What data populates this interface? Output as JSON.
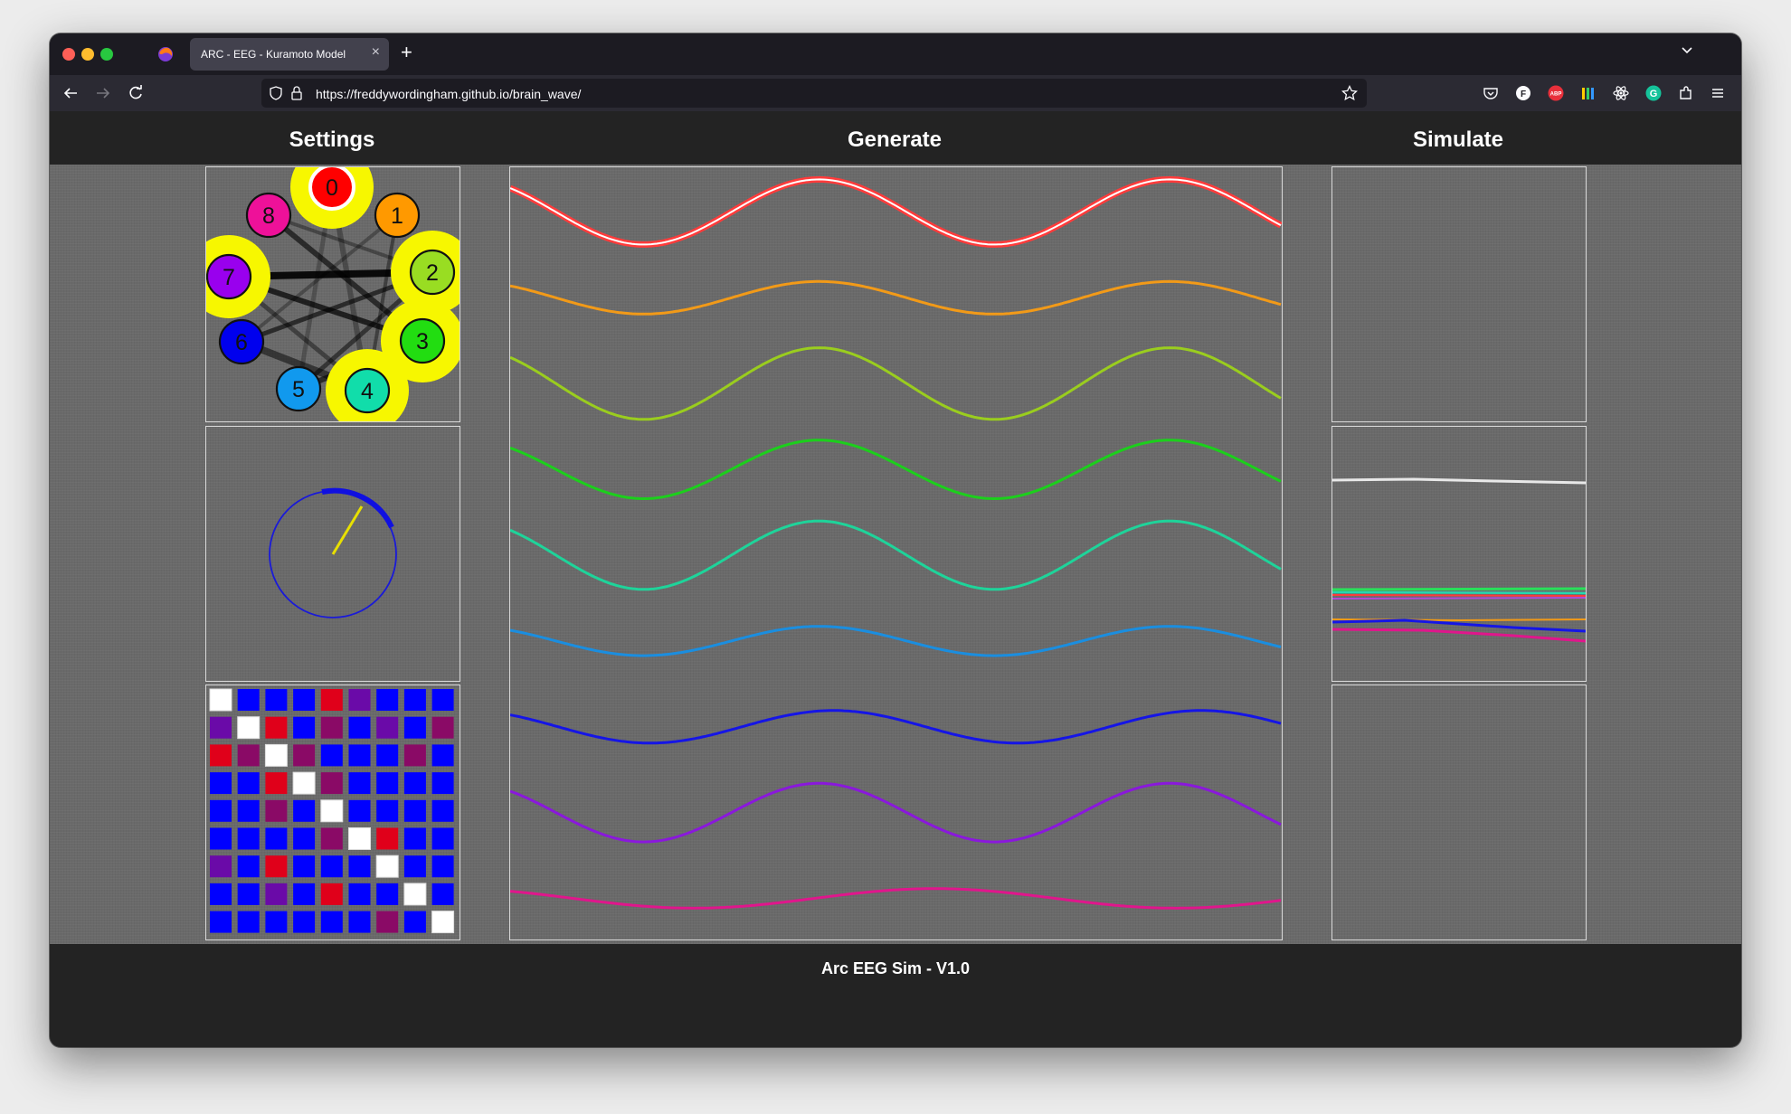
{
  "browser": {
    "tab_title": "ARC - EEG - Kuramoto Model",
    "url": "https://freddywordingham.github.io/brain_wave/",
    "tab_close": "×",
    "new_tab": "+"
  },
  "page": {
    "settings_title": "Settings",
    "generate_title": "Generate",
    "simulate_title": "Simulate",
    "footer": "Arc EEG Sim - V1.0"
  },
  "oscillators": [
    {
      "label": "0",
      "color": "#ff0000",
      "highlight": true
    },
    {
      "label": "1",
      "color": "#ff9900",
      "highlight": false
    },
    {
      "label": "2",
      "color": "#99dd22",
      "highlight": true
    },
    {
      "label": "3",
      "color": "#22dd11",
      "highlight": true
    },
    {
      "label": "4",
      "color": "#11ddaa",
      "highlight": true
    },
    {
      "label": "5",
      "color": "#1199ee",
      "highlight": false
    },
    {
      "label": "6",
      "color": "#0000ee",
      "highlight": false
    },
    {
      "label": "7",
      "color": "#9900ee",
      "highlight": true
    },
    {
      "label": "8",
      "color": "#ee1199",
      "highlight": false
    }
  ],
  "colors": {
    "wave_colors": [
      "#ff3b3b",
      "#f29a18",
      "#9acd1e",
      "#1ccf1c",
      "#1ed49a",
      "#1a8ee0",
      "#1515e6",
      "#8a18dc",
      "#e0168c"
    ],
    "matrix_blue": "#0000ff",
    "matrix_red": "#e0001a",
    "matrix_purple": "#6a0aa8",
    "matrix_magenta": "#8a0a66",
    "matrix_white": "#ffffff"
  },
  "chart_data": [
    {
      "type": "line",
      "title": "Generate",
      "series": [
        {
          "color": "#ff3b3b",
          "amplitude": 1.0,
          "periods": 2.2
        },
        {
          "color": "#f29a18",
          "amplitude": 0.5,
          "periods": 2.2
        },
        {
          "color": "#9acd1e",
          "amplitude": 1.1,
          "periods": 2.2
        },
        {
          "color": "#1ccf1c",
          "amplitude": 0.9,
          "periods": 2.2
        },
        {
          "color": "#1ed49a",
          "amplitude": 1.05,
          "periods": 2.2
        },
        {
          "color": "#1a8ee0",
          "amplitude": 0.45,
          "periods": 2.2
        },
        {
          "color": "#1515e6",
          "amplitude": 0.5,
          "periods": 2.1
        },
        {
          "color": "#8a18dc",
          "amplitude": 0.9,
          "periods": 2.2
        },
        {
          "color": "#e0168c",
          "amplitude": 0.3,
          "periods": 1.6
        }
      ]
    }
  ],
  "phase_matrix": [
    [
      "W",
      "B",
      "B",
      "B",
      "R",
      "P",
      "B",
      "B",
      "B"
    ],
    [
      "P",
      "W",
      "R",
      "B",
      "M",
      "B",
      "P",
      "B",
      "M"
    ],
    [
      "R",
      "M",
      "W",
      "M",
      "B",
      "B",
      "B",
      "M",
      "B"
    ],
    [
      "B",
      "B",
      "R",
      "W",
      "M",
      "B",
      "B",
      "B",
      "B"
    ],
    [
      "B",
      "B",
      "M",
      "B",
      "W",
      "B",
      "B",
      "B",
      "B"
    ],
    [
      "B",
      "B",
      "B",
      "B",
      "M",
      "W",
      "R",
      "B",
      "B"
    ],
    [
      "P",
      "B",
      "R",
      "B",
      "B",
      "B",
      "W",
      "B",
      "B"
    ],
    [
      "B",
      "B",
      "P",
      "B",
      "R",
      "B",
      "B",
      "W",
      "B"
    ],
    [
      "B",
      "B",
      "B",
      "B",
      "B",
      "B",
      "M",
      "B",
      "W"
    ]
  ]
}
